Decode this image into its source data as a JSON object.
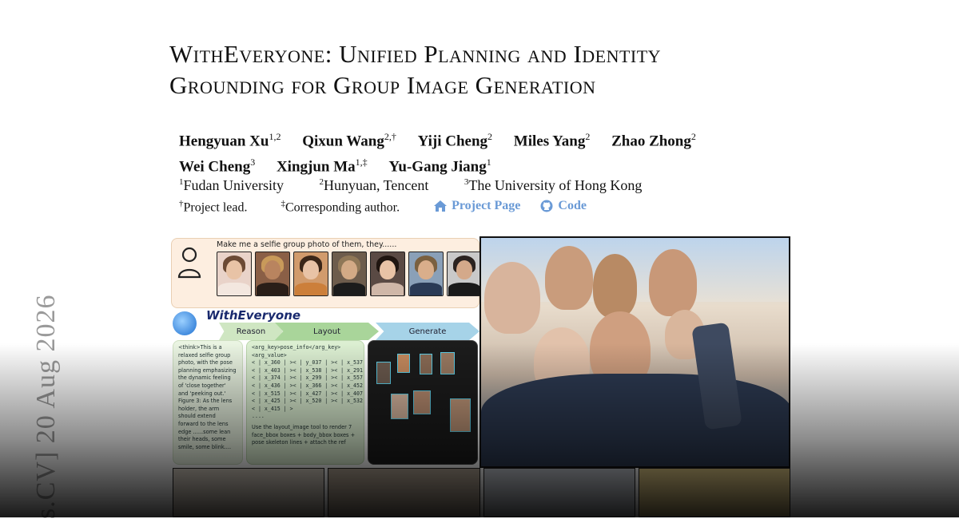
{
  "side_stamp": "s.CV]  20 Aug 2026",
  "title": {
    "line1": "WithEveryone: Unified Planning and Identity",
    "line2": "Grounding for Group Image Generation"
  },
  "authors": [
    {
      "name": "Hengyuan Xu",
      "sup": "1,2"
    },
    {
      "name": "Qixun Wang",
      "sup": "2,†"
    },
    {
      "name": "Yiji Cheng",
      "sup": "2"
    },
    {
      "name": "Miles Yang",
      "sup": "2"
    },
    {
      "name": "Zhao Zhong",
      "sup": "2"
    },
    {
      "name": "Wei Cheng",
      "sup": "3"
    },
    {
      "name": "Xingjun Ma",
      "sup": "1,‡"
    },
    {
      "name": "Yu-Gang Jiang",
      "sup": "1"
    }
  ],
  "affiliations": [
    {
      "sup": "1",
      "name": "Fudan University"
    },
    {
      "sup": "2",
      "name": "Hunyuan, Tencent"
    },
    {
      "sup": "3",
      "name": "The University of Hong Kong"
    }
  ],
  "notes": [
    {
      "sup": "†",
      "text": "Project lead."
    },
    {
      "sup": "‡",
      "text": "Corresponding author."
    }
  ],
  "links": {
    "project_page": "Project Page",
    "code": "Code",
    "color": "#6a9ad6"
  },
  "figure": {
    "prompt": "Make me a selfie group photo of them, they......",
    "brand": "WithEveryone",
    "stages": {
      "reason": "Reason",
      "layout": "Layout",
      "generate": "Generate"
    },
    "reason_text": "<think>This is a relaxed selfie group photo, with the pose planning emphasizing the dynamic feeling of 'close together' and 'peeking out.' Figure 3: As the lens holder, the arm should extend forward to the lens edge ......some lean their heads, some smile, some blink....",
    "layout_header": "<arg_key>pose_info</arg_key>",
    "layout_sub": "<arg_value>",
    "layout_rows": [
      "< | x_360 | >< | y_037 | >< | x_537 | >",
      "< | x_403 | >< | x_538 | >< | x_291 | >",
      "< | x_374 | >< | x_299 | >< | x_557 | >",
      "< | x_436 | >< | x_366 | >< | x_452 | >",
      "< | x_515 | >< | x_427 | >< | x_407 | >",
      "< | x_425 | >< | x_520 | >< | x_532 | >",
      "< | x_415 | >",
      "...."
    ],
    "layout_text": "Use the layout_image tool to render 7 face_bbox boxes + body_bbox boxes + pose skeleton lines + attach the ref"
  }
}
